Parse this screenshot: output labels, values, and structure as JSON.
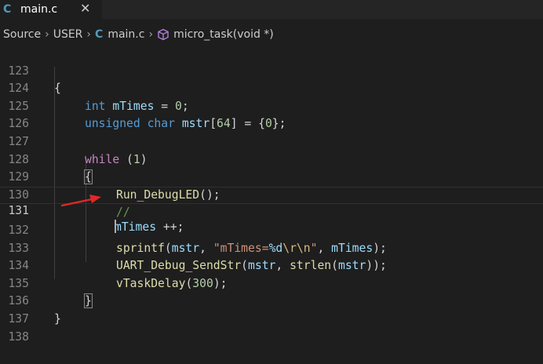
{
  "tab": {
    "icon": "c-file-icon",
    "icon_glyph": "C",
    "label": "main.c",
    "close_glyph": "✕"
  },
  "breadcrumb": {
    "items": [
      "Source",
      "USER",
      "main.c",
      "micro_task(void *)"
    ],
    "c_glyph": "C",
    "separator": "›"
  },
  "editor": {
    "lines": [
      {
        "num": "123"
      },
      {
        "num": "124"
      },
      {
        "num": "125"
      },
      {
        "num": "126"
      },
      {
        "num": "127"
      },
      {
        "num": "128"
      },
      {
        "num": "129"
      },
      {
        "num": "130"
      },
      {
        "num": "131"
      },
      {
        "num": "132"
      },
      {
        "num": "133"
      },
      {
        "num": "134"
      },
      {
        "num": "135"
      },
      {
        "num": "136"
      },
      {
        "num": "137"
      },
      {
        "num": "138"
      }
    ],
    "tokens": {
      "l123_brace": "{",
      "l124_type": "int",
      "l124_var": "mTimes",
      "l124_eq": " = ",
      "l124_num": "0",
      "l124_semi": ";",
      "l125_type1": "unsigned",
      "l125_type2": "char",
      "l125_var": "mstr",
      "l125_open": "[",
      "l125_num": "64",
      "l125_rest": "] = {",
      "l125_num2": "0",
      "l125_end": "};",
      "l127_kw": "while",
      "l127_open": " (",
      "l127_num": "1",
      "l127_close": ")",
      "l128_brace": "{",
      "l129_fn": "Run_DebugLED",
      "l129_rest": "();",
      "l130_cmt": "//",
      "l131_var": "mTimes",
      "l131_rest": " ++;",
      "l132_fn": "sprintf",
      "l132_open": "(",
      "l132_var": "mstr",
      "l132_comma": ", ",
      "l132_str1": "\"mTimes=",
      "l132_fmt": "%d",
      "l132_esc": "\\r\\n",
      "l132_str2": "\"",
      "l132_comma2": ", ",
      "l132_var2": "mTimes",
      "l132_end": ");",
      "l133_fn": "UART_Debug_SendStr",
      "l133_open": "(",
      "l133_var": "mstr",
      "l133_comma": ", ",
      "l133_fn2": "strlen",
      "l133_open2": "(",
      "l133_var2": "mstr",
      "l133_end": "));",
      "l134_fn": "vTaskDelay",
      "l134_open": "(",
      "l134_num": "300",
      "l134_end": ");",
      "l135_brace": "}",
      "l136_brace": "}"
    },
    "current_line": "131"
  },
  "colors": {
    "background": "#1e1e1e",
    "keyword": "#569cd6",
    "control": "#c586c0",
    "variable": "#9cdcfe",
    "number": "#b5cea8",
    "function": "#dcdcaa",
    "string": "#ce9178",
    "comment": "#6a9955",
    "annotation_arrow": "#e0282a"
  }
}
